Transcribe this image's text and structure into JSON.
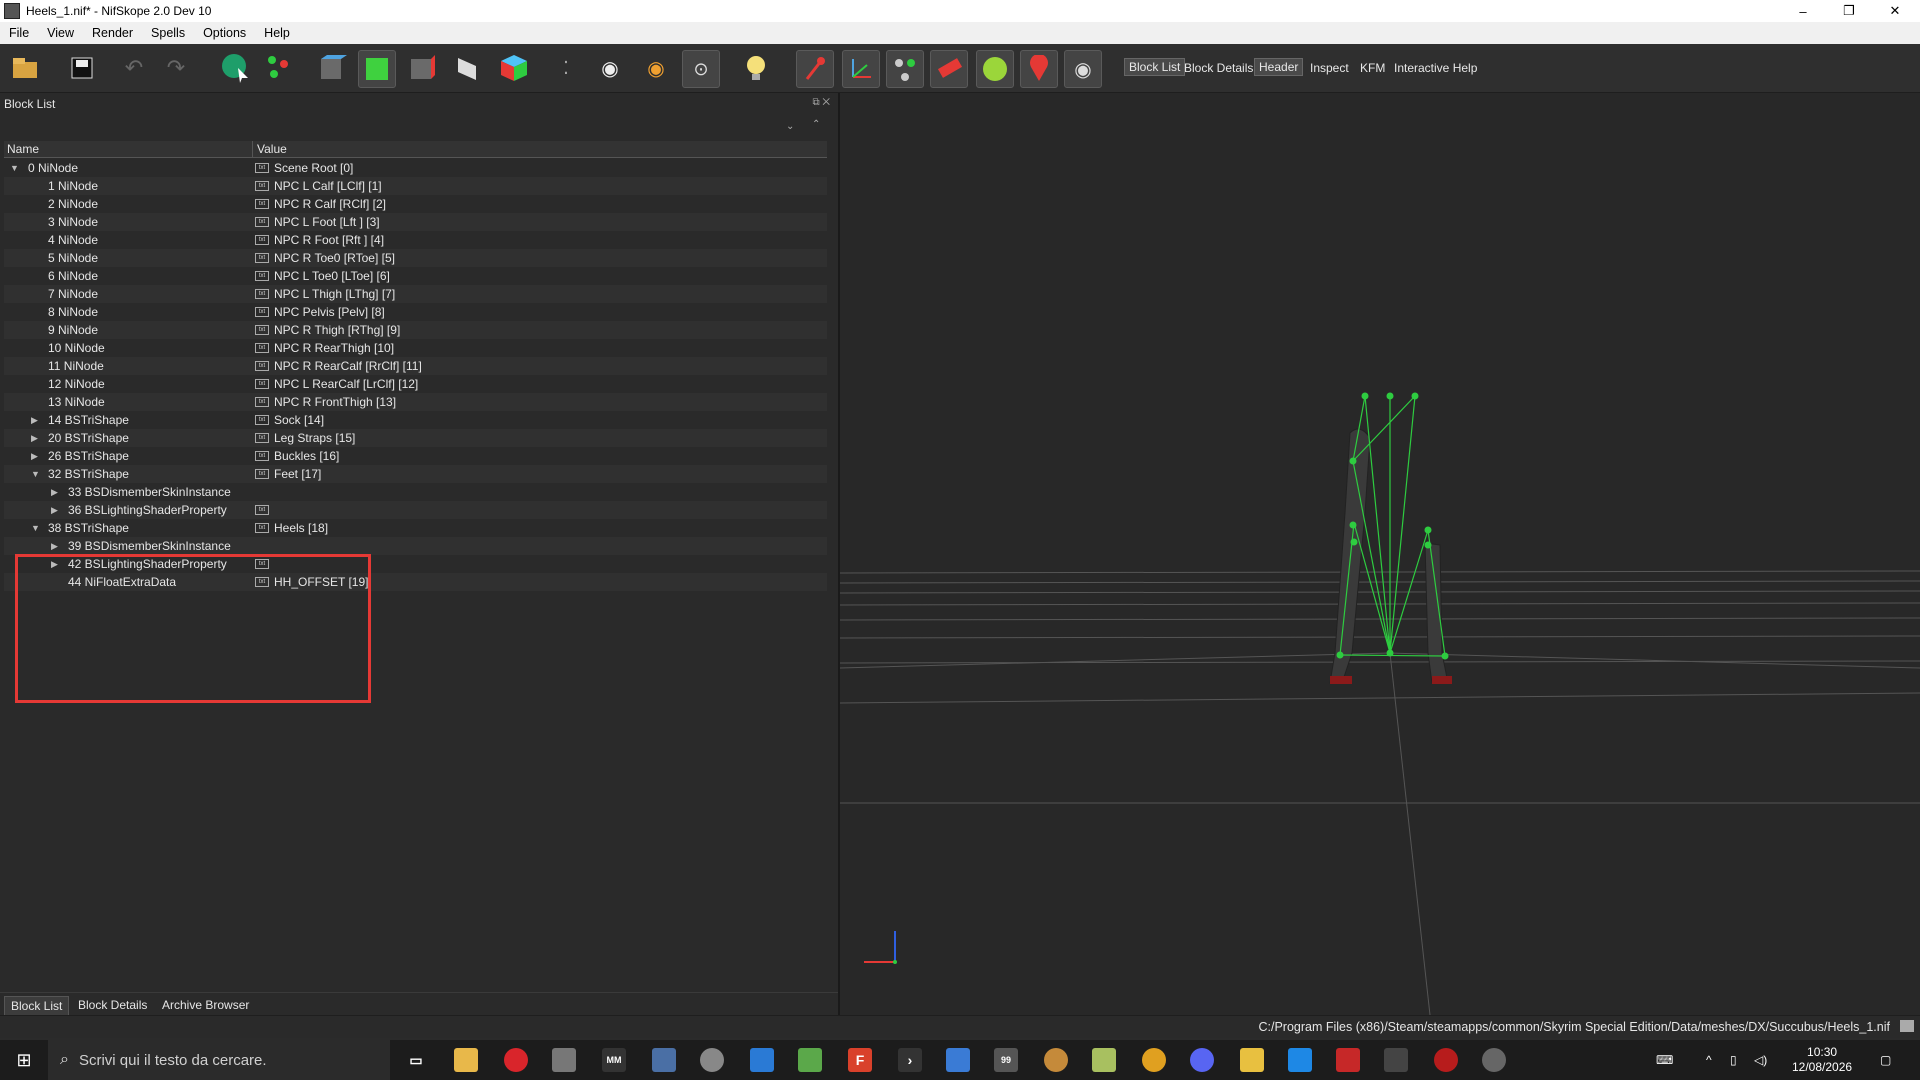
{
  "window": {
    "title": "Heels_1.nif* - NifSkope 2.0 Dev 10",
    "minimize": "–",
    "maximize": "❐",
    "close": "✕"
  },
  "menu": [
    "File",
    "View",
    "Render",
    "Spells",
    "Options",
    "Help"
  ],
  "toolbar": {
    "tabs": [
      "Block List",
      "Block Details",
      "Header",
      "Inspect",
      "KFM",
      "Interactive Help"
    ]
  },
  "block_list": {
    "title": "Block List",
    "columns": {
      "name": "Name",
      "value": "Value"
    },
    "rows": [
      {
        "expander": "▼",
        "name": "0 NiNode",
        "value": "Scene Root [0]"
      },
      {
        "expander": "",
        "name": "1 NiNode",
        "value": "NPC L Calf [LClf] [1]"
      },
      {
        "expander": "",
        "name": "2 NiNode",
        "value": "NPC R Calf [RClf] [2]"
      },
      {
        "expander": "",
        "name": "3 NiNode",
        "value": "NPC L Foot [Lft ] [3]"
      },
      {
        "expander": "",
        "name": "4 NiNode",
        "value": "NPC R Foot [Rft ] [4]"
      },
      {
        "expander": "",
        "name": "5 NiNode",
        "value": "NPC R Toe0 [RToe] [5]"
      },
      {
        "expander": "",
        "name": "6 NiNode",
        "value": "NPC L Toe0 [LToe] [6]"
      },
      {
        "expander": "",
        "name": "7 NiNode",
        "value": "NPC L Thigh [LThg] [7]"
      },
      {
        "expander": "",
        "name": "8 NiNode",
        "value": "NPC Pelvis [Pelv] [8]"
      },
      {
        "expander": "",
        "name": "9 NiNode",
        "value": "NPC R Thigh [RThg] [9]"
      },
      {
        "expander": "",
        "name": "10 NiNode",
        "value": "NPC R RearThigh [10]"
      },
      {
        "expander": "",
        "name": "11 NiNode",
        "value": "NPC R RearCalf [RrClf] [11]"
      },
      {
        "expander": "",
        "name": "12 NiNode",
        "value": "NPC L RearCalf [LrClf] [12]"
      },
      {
        "expander": "",
        "name": "13 NiNode",
        "value": "NPC R FrontThigh [13]"
      },
      {
        "expander": "▶",
        "name": "14 BSTriShape",
        "value": "Sock [14]"
      },
      {
        "expander": "▶",
        "name": "20 BSTriShape",
        "value": "Leg Straps [15]"
      },
      {
        "expander": "▶",
        "name": "26 BSTriShape",
        "value": "Buckles [16]"
      },
      {
        "expander": "▼",
        "name": "32 BSTriShape",
        "value": "Feet [17]"
      },
      {
        "expander": "▶",
        "name": "33 BSDismemberSkinInstance",
        "value": ""
      },
      {
        "expander": "▶",
        "name": "36 BSLightingShaderProperty",
        "value": ""
      },
      {
        "expander": "▼",
        "name": "38 BSTriShape",
        "value": "Heels [18]"
      },
      {
        "expander": "▶",
        "name": "39 BSDismemberSkinInstance",
        "value": ""
      },
      {
        "expander": "▶",
        "name": "42 BSLightingShaderProperty",
        "value": ""
      },
      {
        "expander": "",
        "name": "44 NiFloatExtraData",
        "value": "HH_OFFSET [19]"
      }
    ]
  },
  "bottom_tabs": [
    "Block List",
    "Block Details",
    "Archive Browser"
  ],
  "status": {
    "path": "C:/Program Files (x86)/Steam/steamapps/common/Skyrim Special Edition/Data/meshes/DX/Succubus/Heels_1.nif"
  },
  "taskbar": {
    "search_placeholder": "Scrivi qui il testo da cercare.",
    "time": "10:30",
    "date": "12/08/2026"
  },
  "colors": {
    "highlight": "#e53935",
    "skeleton": "#2ecc40"
  }
}
